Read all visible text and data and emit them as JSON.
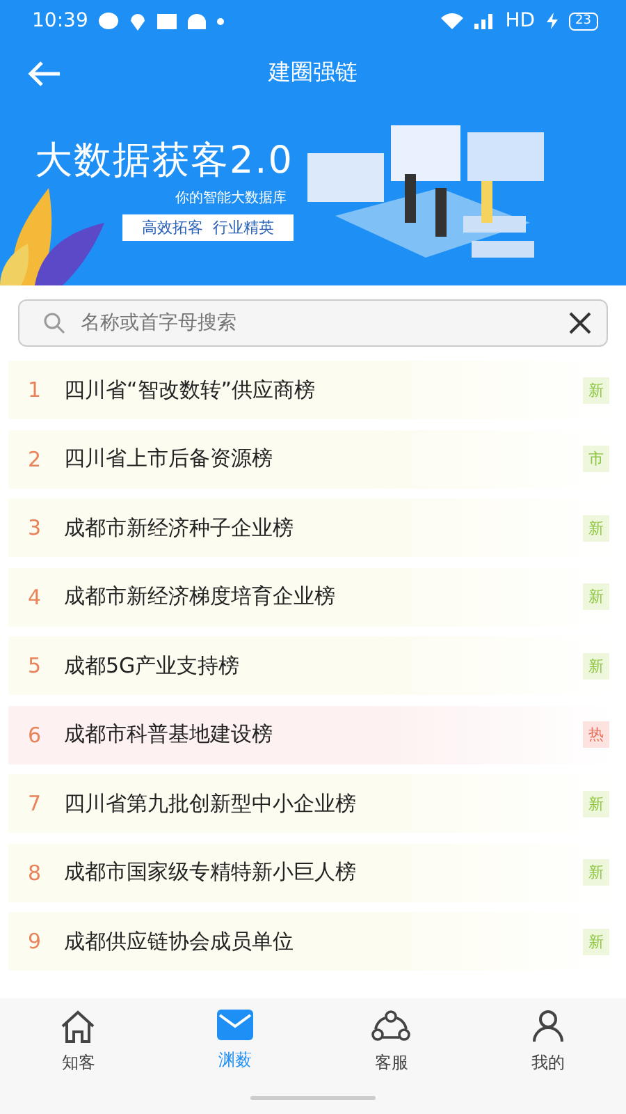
{
  "status_bar": {
    "time": "10:39",
    "network": "HD",
    "battery": "23"
  },
  "header": {
    "title": "建圈强链"
  },
  "banner": {
    "headline": "大数据获客2.0",
    "subtitle": "你的智能大数据库",
    "slogan": "高效拓客  行业精英"
  },
  "search": {
    "placeholder": "名称或首字母搜索"
  },
  "list": [
    {
      "rank": "1",
      "name": "四川省“智改数转”供应商榜",
      "tag": "新",
      "kind": "new"
    },
    {
      "rank": "2",
      "name": "四川省上市后备资源榜",
      "tag": "市",
      "kind": "new"
    },
    {
      "rank": "3",
      "name": "成都市新经济种子企业榜",
      "tag": "新",
      "kind": "new"
    },
    {
      "rank": "4",
      "name": "成都市新经济梯度培育企业榜",
      "tag": "新",
      "kind": "new"
    },
    {
      "rank": "5",
      "name": "成都5G产业支持榜",
      "tag": "新",
      "kind": "new"
    },
    {
      "rank": "6",
      "name": "成都市科普基地建设榜",
      "tag": "热",
      "kind": "hot"
    },
    {
      "rank": "7",
      "name": "四川省第九批创新型中小企业榜",
      "tag": "新",
      "kind": "new"
    },
    {
      "rank": "8",
      "name": "成都市国家级专精特新小巨人榜",
      "tag": "新",
      "kind": "new"
    },
    {
      "rank": "9",
      "name": "成都供应链协会成员单位",
      "tag": "新",
      "kind": "new"
    }
  ],
  "tabbar": [
    {
      "label": "知客",
      "kind": "home",
      "selected": false
    },
    {
      "label": "渊薮",
      "kind": "mail",
      "selected": true
    },
    {
      "label": "客服",
      "kind": "network",
      "selected": false
    },
    {
      "label": "我的",
      "kind": "person",
      "selected": false
    }
  ]
}
